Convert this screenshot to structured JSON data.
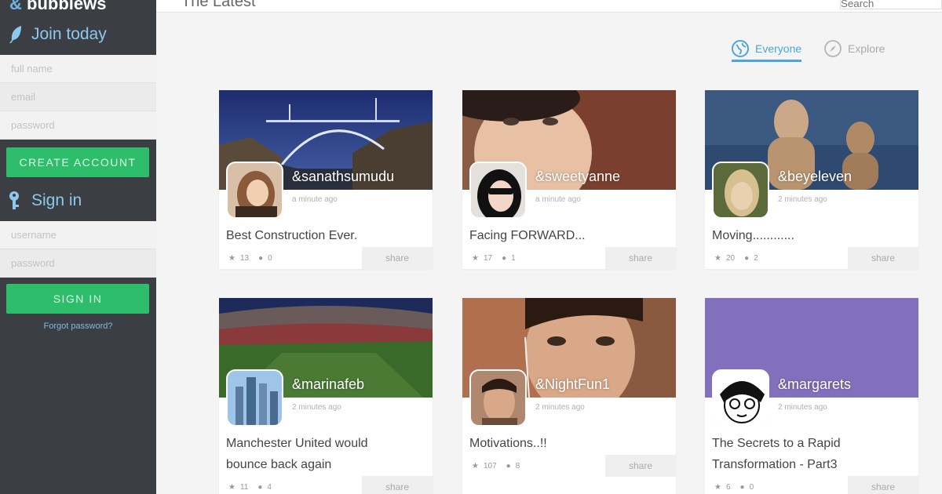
{
  "brand": {
    "amp": "&",
    "name": "bubblews"
  },
  "topbar": {
    "title": "The Latest",
    "search_placeholder": "Search"
  },
  "signup": {
    "heading": "Join today",
    "fullname_placeholder": "full name",
    "email_placeholder": "email",
    "password_placeholder": "password",
    "button": "CREATE ACCOUNT"
  },
  "signin": {
    "heading": "Sign in",
    "username_placeholder": "username",
    "password_placeholder": "password",
    "button": "SIGN IN",
    "forgot": "Forgot password?"
  },
  "tabs": [
    {
      "label": "Everyone",
      "icon": "globe-icon",
      "active": true
    },
    {
      "label": "Explore",
      "icon": "compass-icon",
      "active": false
    }
  ],
  "share_label": "share",
  "posts": [
    {
      "handle": "&sanathsumudu",
      "time": "a minute ago",
      "caption": [
        "Best Construction Ever."
      ],
      "stars": "13",
      "comments": "0"
    },
    {
      "handle": "&sweetyanne",
      "time": "a minute ago",
      "caption": [
        "Facing FORWARD..."
      ],
      "stars": "17",
      "comments": "1"
    },
    {
      "handle": "&beyeleven",
      "time": "2 minutes ago",
      "caption": [
        "Moving............"
      ],
      "stars": "20",
      "comments": "2"
    },
    {
      "handle": "&marinafeb",
      "time": "2 minutes ago",
      "caption": [
        "Manchester United would",
        "bounce back again"
      ],
      "stars": "11",
      "comments": "4"
    },
    {
      "handle": "&NightFun1",
      "time": "2 minutes ago",
      "caption": [
        "Motivations..!!"
      ],
      "stars": "107",
      "comments": "8"
    },
    {
      "handle": "&margarets",
      "time": "2 minutes ago",
      "caption": [
        "The Secrets to a Rapid",
        "Transformation - Part3"
      ],
      "stars": "6",
      "comments": "0"
    }
  ],
  "colors": {
    "sidebar": "#3b3f44",
    "accent": "#4aa6dc",
    "green": "#2ebd6b",
    "purple": "#8270bd"
  }
}
